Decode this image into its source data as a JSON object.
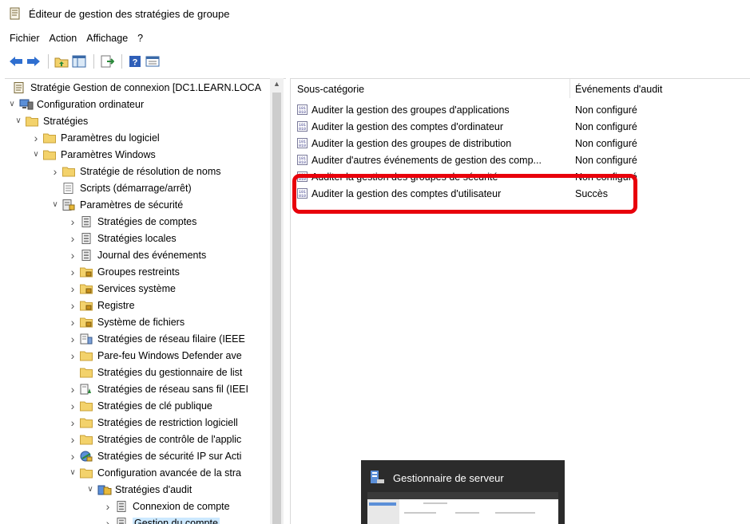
{
  "window": {
    "title": "Éditeur de gestion des stratégies de groupe"
  },
  "menu": [
    "Fichier",
    "Action",
    "Affichage",
    "?"
  ],
  "toolbar": {
    "buttons": [
      "back-arrow-icon",
      "forward-arrow-icon",
      "up-folder-icon",
      "show-hide-tree-icon",
      "export-list-icon",
      "help-icon",
      "view-icon"
    ]
  },
  "tree": [
    {
      "label": "Stratégie Gestion de connexion [DC1.LEARN.LOCA",
      "level": 0,
      "chev": "",
      "icon": "policy"
    },
    {
      "label": "Configuration ordinateur",
      "level": 0,
      "chev": "down",
      "icon": "computer"
    },
    {
      "label": "Stratégies",
      "level": 1,
      "chev": "down",
      "icon": "folder"
    },
    {
      "label": "Paramètres du logiciel",
      "level": 2,
      "chev": "right",
      "icon": "folder"
    },
    {
      "label": "Paramètres Windows",
      "level": 2,
      "chev": "down",
      "icon": "folder"
    },
    {
      "label": "Stratégie de résolution de noms",
      "level": 3,
      "chev": "right",
      "icon": "folder"
    },
    {
      "label": "Scripts (démarrage/arrêt)",
      "level": 3,
      "chev": "",
      "icon": "script"
    },
    {
      "label": "Paramètres de sécurité",
      "level": 3,
      "chev": "down",
      "icon": "security"
    },
    {
      "label": "Stratégies de comptes",
      "level": 4,
      "chev": "right",
      "icon": "doc"
    },
    {
      "label": "Stratégies locales",
      "level": 4,
      "chev": "right",
      "icon": "doc"
    },
    {
      "label": "Journal des événements",
      "level": 4,
      "chev": "right",
      "icon": "doc"
    },
    {
      "label": "Groupes restreints",
      "level": 4,
      "chev": "right",
      "icon": "lockfolder"
    },
    {
      "label": "Services système",
      "level": 4,
      "chev": "right",
      "icon": "lockfolder"
    },
    {
      "label": "Registre",
      "level": 4,
      "chev": "right",
      "icon": "lockfolder"
    },
    {
      "label": "Système de fichiers",
      "level": 4,
      "chev": "right",
      "icon": "lockfolder"
    },
    {
      "label": "Stratégies de réseau filaire (IEEE",
      "level": 4,
      "chev": "right",
      "icon": "network"
    },
    {
      "label": "Pare-feu Windows Defender ave",
      "level": 4,
      "chev": "right",
      "icon": "folder"
    },
    {
      "label": "Stratégies du gestionnaire de list",
      "level": 4,
      "chev": "",
      "icon": "folder"
    },
    {
      "label": "Stratégies de réseau sans fil (IEEI",
      "level": 4,
      "chev": "right",
      "icon": "wireless"
    },
    {
      "label": "Stratégies de clé publique",
      "level": 4,
      "chev": "right",
      "icon": "folder"
    },
    {
      "label": "Stratégies de restriction logiciell",
      "level": 4,
      "chev": "right",
      "icon": "folder"
    },
    {
      "label": "Stratégies de contrôle de l'applic",
      "level": 4,
      "chev": "right",
      "icon": "folder"
    },
    {
      "label": "Stratégies de sécurité IP sur Acti",
      "level": 4,
      "chev": "right",
      "icon": "ipsec"
    },
    {
      "label": "Configuration avancée de la stra",
      "level": 4,
      "chev": "down",
      "icon": "folder"
    },
    {
      "label": "Stratégies d'audit",
      "level": 5,
      "chev": "down",
      "icon": "audit"
    },
    {
      "label": "Connexion de compte",
      "level": 6,
      "chev": "right",
      "icon": "doc"
    },
    {
      "label": "Gestion du compte",
      "level": 6,
      "chev": "right",
      "icon": "doc",
      "selected": true
    }
  ],
  "list": {
    "columns": [
      "Sous-catégorie",
      "Événements d'audit"
    ],
    "rows": [
      {
        "name": "Auditer la gestion des groupes d'applications",
        "value": "Non configuré"
      },
      {
        "name": "Auditer la gestion des comptes d'ordinateur",
        "value": "Non configuré"
      },
      {
        "name": "Auditer la gestion des groupes de distribution",
        "value": "Non configuré"
      },
      {
        "name": "Auditer d'autres événements de gestion des comp...",
        "value": "Non configuré"
      },
      {
        "name": "Auditer la gestion des groupes de sécurité",
        "value": "Non configuré"
      },
      {
        "name": "Auditer la gestion des comptes d'utilisateur",
        "value": "Succès"
      }
    ]
  },
  "taskbar_preview": {
    "title": "Gestionnaire de serveur"
  },
  "colors": {
    "highlight": "#e8000b",
    "selection": "#cce8ff",
    "folder": "#f3d26b"
  }
}
